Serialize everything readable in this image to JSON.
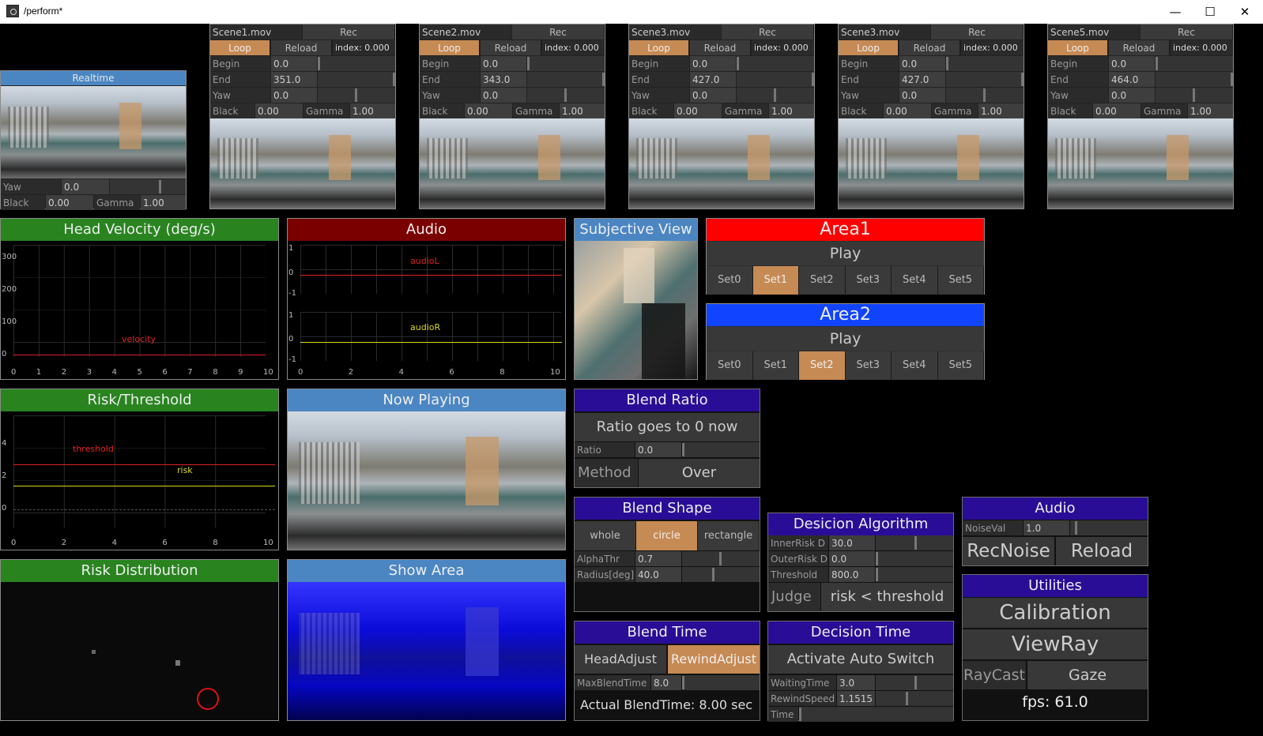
{
  "window": {
    "title": "/perform*",
    "minimize": "—",
    "maximize": "☐",
    "close": "✕"
  },
  "realtime": {
    "header": "Realtime",
    "yaw_label": "Yaw",
    "yaw": "0.0",
    "black_label": "Black",
    "black": "0.00",
    "gamma_label": "Gamma",
    "gamma": "1.00"
  },
  "scenes": [
    {
      "file": "Scene1.mov",
      "rec": "Rec",
      "loop": "Loop",
      "reload": "Reload",
      "index": "index: 0.000",
      "begin_label": "Begin",
      "begin": "0.0",
      "end_label": "End",
      "end": "351.0",
      "yaw_label": "Yaw",
      "yaw": "0.0",
      "black_label": "Black",
      "black": "0.00",
      "gamma_label": "Gamma",
      "gamma": "1.00"
    },
    {
      "file": "Scene2.mov",
      "rec": "Rec",
      "loop": "Loop",
      "reload": "Reload",
      "index": "index: 0.000",
      "begin_label": "Begin",
      "begin": "0.0",
      "end_label": "End",
      "end": "343.0",
      "yaw_label": "Yaw",
      "yaw": "0.0",
      "black_label": "Black",
      "black": "0.00",
      "gamma_label": "Gamma",
      "gamma": "1.00"
    },
    {
      "file": "Scene3.mov",
      "rec": "Rec",
      "loop": "Loop",
      "reload": "Reload",
      "index": "index: 0.000",
      "begin_label": "Begin",
      "begin": "0.0",
      "end_label": "End",
      "end": "427.0",
      "yaw_label": "Yaw",
      "yaw": "0.0",
      "black_label": "Black",
      "black": "0.00",
      "gamma_label": "Gamma",
      "gamma": "1.00"
    },
    {
      "file": "Scene3.mov",
      "rec": "Rec",
      "loop": "Loop",
      "reload": "Reload",
      "index": "index: 0.000",
      "begin_label": "Begin",
      "begin": "0.0",
      "end_label": "End",
      "end": "427.0",
      "yaw_label": "Yaw",
      "yaw": "0.0",
      "black_label": "Black",
      "black": "0.00",
      "gamma_label": "Gamma",
      "gamma": "1.00"
    },
    {
      "file": "Scene5.mov",
      "rec": "Rec",
      "loop": "Loop",
      "reload": "Reload",
      "index": "index: 0.000",
      "begin_label": "Begin",
      "begin": "0.0",
      "end_label": "End",
      "end": "464.0",
      "yaw_label": "Yaw",
      "yaw": "0.0",
      "black_label": "Black",
      "black": "0.00",
      "gamma_label": "Gamma",
      "gamma": "1.00"
    }
  ],
  "head_velocity": {
    "title": "Head Velocity (deg/s)",
    "series_label": "velocity",
    "yticks": [
      "300",
      "200",
      "100",
      "0"
    ],
    "xticks": [
      "0",
      "1",
      "2",
      "3",
      "4",
      "5",
      "6",
      "7",
      "8",
      "9",
      "10"
    ]
  },
  "audio_plot": {
    "title": "Audio",
    "left_label": "audioL",
    "right_label": "audioR",
    "yticks_top": [
      "1",
      "0",
      "-1"
    ],
    "yticks_bottom": [
      "1",
      "0",
      "-1"
    ],
    "xticks": [
      "0",
      "2",
      "4",
      "6",
      "8",
      "10"
    ]
  },
  "subjective_view": {
    "title": "Subjective View"
  },
  "risk_threshold": {
    "title": "Risk/Threshold",
    "threshold_label": "threshold",
    "risk_label": "risk",
    "yticks": [
      "4",
      "2",
      "0"
    ],
    "xticks": [
      "0",
      "2",
      "4",
      "6",
      "8",
      "10"
    ]
  },
  "now_playing": {
    "title": "Now Playing"
  },
  "risk_distribution": {
    "title": "Risk Distribution"
  },
  "show_area": {
    "title": "Show Area"
  },
  "area1": {
    "title": "Area1",
    "play": "Play",
    "sets": [
      "Set0",
      "Set1",
      "Set2",
      "Set3",
      "Set4",
      "Set5"
    ],
    "active": 1
  },
  "area2": {
    "title": "Area2",
    "play": "Play",
    "sets": [
      "Set0",
      "Set1",
      "Set2",
      "Set3",
      "Set4",
      "Set5"
    ],
    "active": 2
  },
  "blend_ratio": {
    "title": "Blend Ratio",
    "message": "Ratio goes to 0 now",
    "ratio_label": "Ratio",
    "ratio": "0.0",
    "method_label": "Method",
    "method": "Over"
  },
  "blend_shape": {
    "title": "Blend Shape",
    "shapes": [
      "whole",
      "circle",
      "rectangle"
    ],
    "active": 1,
    "alpha_label": "AlphaThr",
    "alpha": "0.7",
    "radius_label": "Radius[deg]",
    "radius": "40.0"
  },
  "decision_algorithm": {
    "title": "Desicion Algorithm",
    "inner_label": "InnerRisk D",
    "inner": "30.0",
    "outer_label": "OuterRisk D",
    "outer": "0.0",
    "threshold_label": "Threshold",
    "threshold": "800.0",
    "judge_label": "Judge",
    "judge": "risk < threshold"
  },
  "audio_panel": {
    "title": "Audio",
    "noise_label": "NoiseVal",
    "noise": "1.0",
    "recnoise": "RecNoise",
    "reload": "Reload"
  },
  "blend_time": {
    "title": "Blend Time",
    "head_adjust": "HeadAdjust",
    "rewind_adjust": "RewindAdjust",
    "max_label": "MaxBlendTime",
    "max": "8.0",
    "actual": "Actual BlendTime: 8.00 sec"
  },
  "decision_time": {
    "title": "Decision Time",
    "auto": "Activate Auto Switch",
    "waiting_label": "WaitingTime",
    "waiting": "3.0",
    "rewind_label": "RewindSpeed",
    "rewind": "1.1515",
    "time_label": "Time"
  },
  "utilities": {
    "title": "Utilities",
    "calibration": "Calibration",
    "viewray": "ViewRay",
    "raycast": "RayCast",
    "gaze": "Gaze",
    "fps": "fps: 61.0"
  },
  "colors": {
    "accent_orange": "#c68a54",
    "header_green": "#298420",
    "header_red": "#7a0000",
    "header_blue": "#4b86c3",
    "header_purple": "#2a0d96",
    "area1_red": "#ff0000",
    "area2_blue": "#1144ff"
  }
}
